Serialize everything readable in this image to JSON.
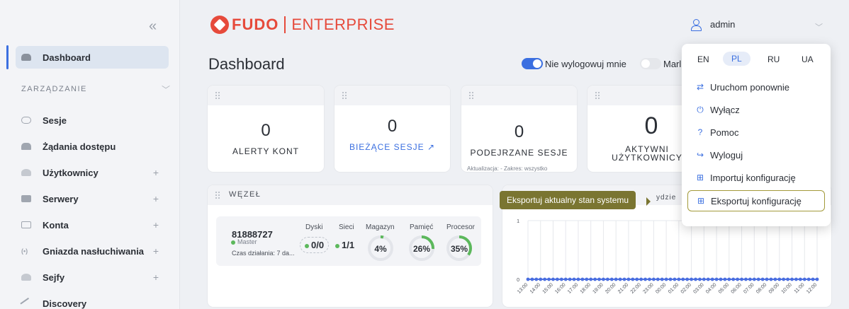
{
  "header": {
    "logo_brand": "FUDO",
    "logo_edition": "ENTERPRISE",
    "page_title": "Dashboard",
    "keep_logged_in_label": "Nie wylogowuj mnie",
    "keep_logged_in": true,
    "second_toggle_label": "Marl",
    "second_toggle": false,
    "user_name": "admin"
  },
  "sidebar": {
    "collapse_glyph": "«",
    "section_label": "ZARZĄDZANIE",
    "items": [
      {
        "label": "Dashboard",
        "icon": "dashboard-icon",
        "active": true
      },
      {
        "label": "Sesje",
        "icon": "sessions-icon"
      },
      {
        "label": "Żądania dostępu",
        "icon": "access-requests-icon"
      },
      {
        "label": "Użytkownicy",
        "icon": "users-icon",
        "expandable": true
      },
      {
        "label": "Serwery",
        "icon": "servers-icon",
        "expandable": true
      },
      {
        "label": "Konta",
        "icon": "accounts-icon",
        "expandable": true
      },
      {
        "label": "Gniazda nasłuchiwania",
        "icon": "listeners-icon",
        "expandable": true
      },
      {
        "label": "Sejfy",
        "icon": "safes-icon",
        "expandable": true
      },
      {
        "label": "Discovery",
        "icon": "discovery-icon"
      }
    ]
  },
  "stats": [
    {
      "value": "0",
      "label": "ALERTY KONT"
    },
    {
      "value": "0",
      "label": "BIEŻĄCE SESJE ↗"
    },
    {
      "value": "0",
      "label": "PODEJRZANE SESJE",
      "meta": "Aktualizacja: -    Zakres: wszystko"
    },
    {
      "value": "0",
      "label_line1": "AKTYWNI",
      "label_line2": "UŻYTKOWNICY"
    }
  ],
  "node": {
    "title": "WĘZEŁ",
    "id": "81888727",
    "role": "Master",
    "uptime": "Czas działania: 7 da...",
    "columns": {
      "disks": "Dyski",
      "networks": "Sieci",
      "storage": "Magazyn",
      "memory": "Pamięć",
      "cpu": "Procesor"
    },
    "disks": "0/0",
    "networks": "1/1",
    "storage": "4%",
    "memory": "26%",
    "cpu": "35%",
    "storage_pct": 4,
    "memory_pct": 26,
    "cpu_pct": 35
  },
  "chart_panel": {
    "title_peek": "ydzie"
  },
  "tooltip": {
    "text": "Eksportuj aktualny stan systemu"
  },
  "menu": {
    "languages": [
      "EN",
      "PL",
      "RU",
      "UA"
    ],
    "selected_language": "PL",
    "items": [
      {
        "label": "Uruchom ponownie",
        "icon": "restart-icon"
      },
      {
        "label": "Wyłącz",
        "icon": "power-icon"
      },
      {
        "label": "Pomoc",
        "icon": "help-icon"
      },
      {
        "label": "Wyloguj",
        "icon": "logout-icon"
      },
      {
        "label": "Importuj konfigurację",
        "icon": "import-icon"
      },
      {
        "label": "Eksportuj konfigurację",
        "icon": "export-icon"
      }
    ]
  },
  "chart_data": {
    "type": "line",
    "ylim": [
      0,
      1
    ],
    "y_ticks": [
      "0",
      "1"
    ],
    "x": [
      "13:00",
      "14:00",
      "15:00",
      "16:00",
      "17:00",
      "18:00",
      "19:00",
      "20:00",
      "21:00",
      "22:00",
      "23:00",
      "00:00",
      "01:00",
      "02:00",
      "03:00",
      "04:00",
      "05:00",
      "06:00",
      "07:00",
      "08:00",
      "09:00",
      "10:00",
      "11:00",
      "12:00"
    ],
    "series": [
      {
        "values": [
          0,
          0,
          0,
          0,
          0,
          0,
          0,
          0,
          0,
          0,
          0,
          0,
          0,
          0,
          0,
          0,
          0,
          0,
          0,
          0,
          0,
          0,
          0,
          0
        ],
        "color": "#4a6ee0"
      }
    ]
  }
}
